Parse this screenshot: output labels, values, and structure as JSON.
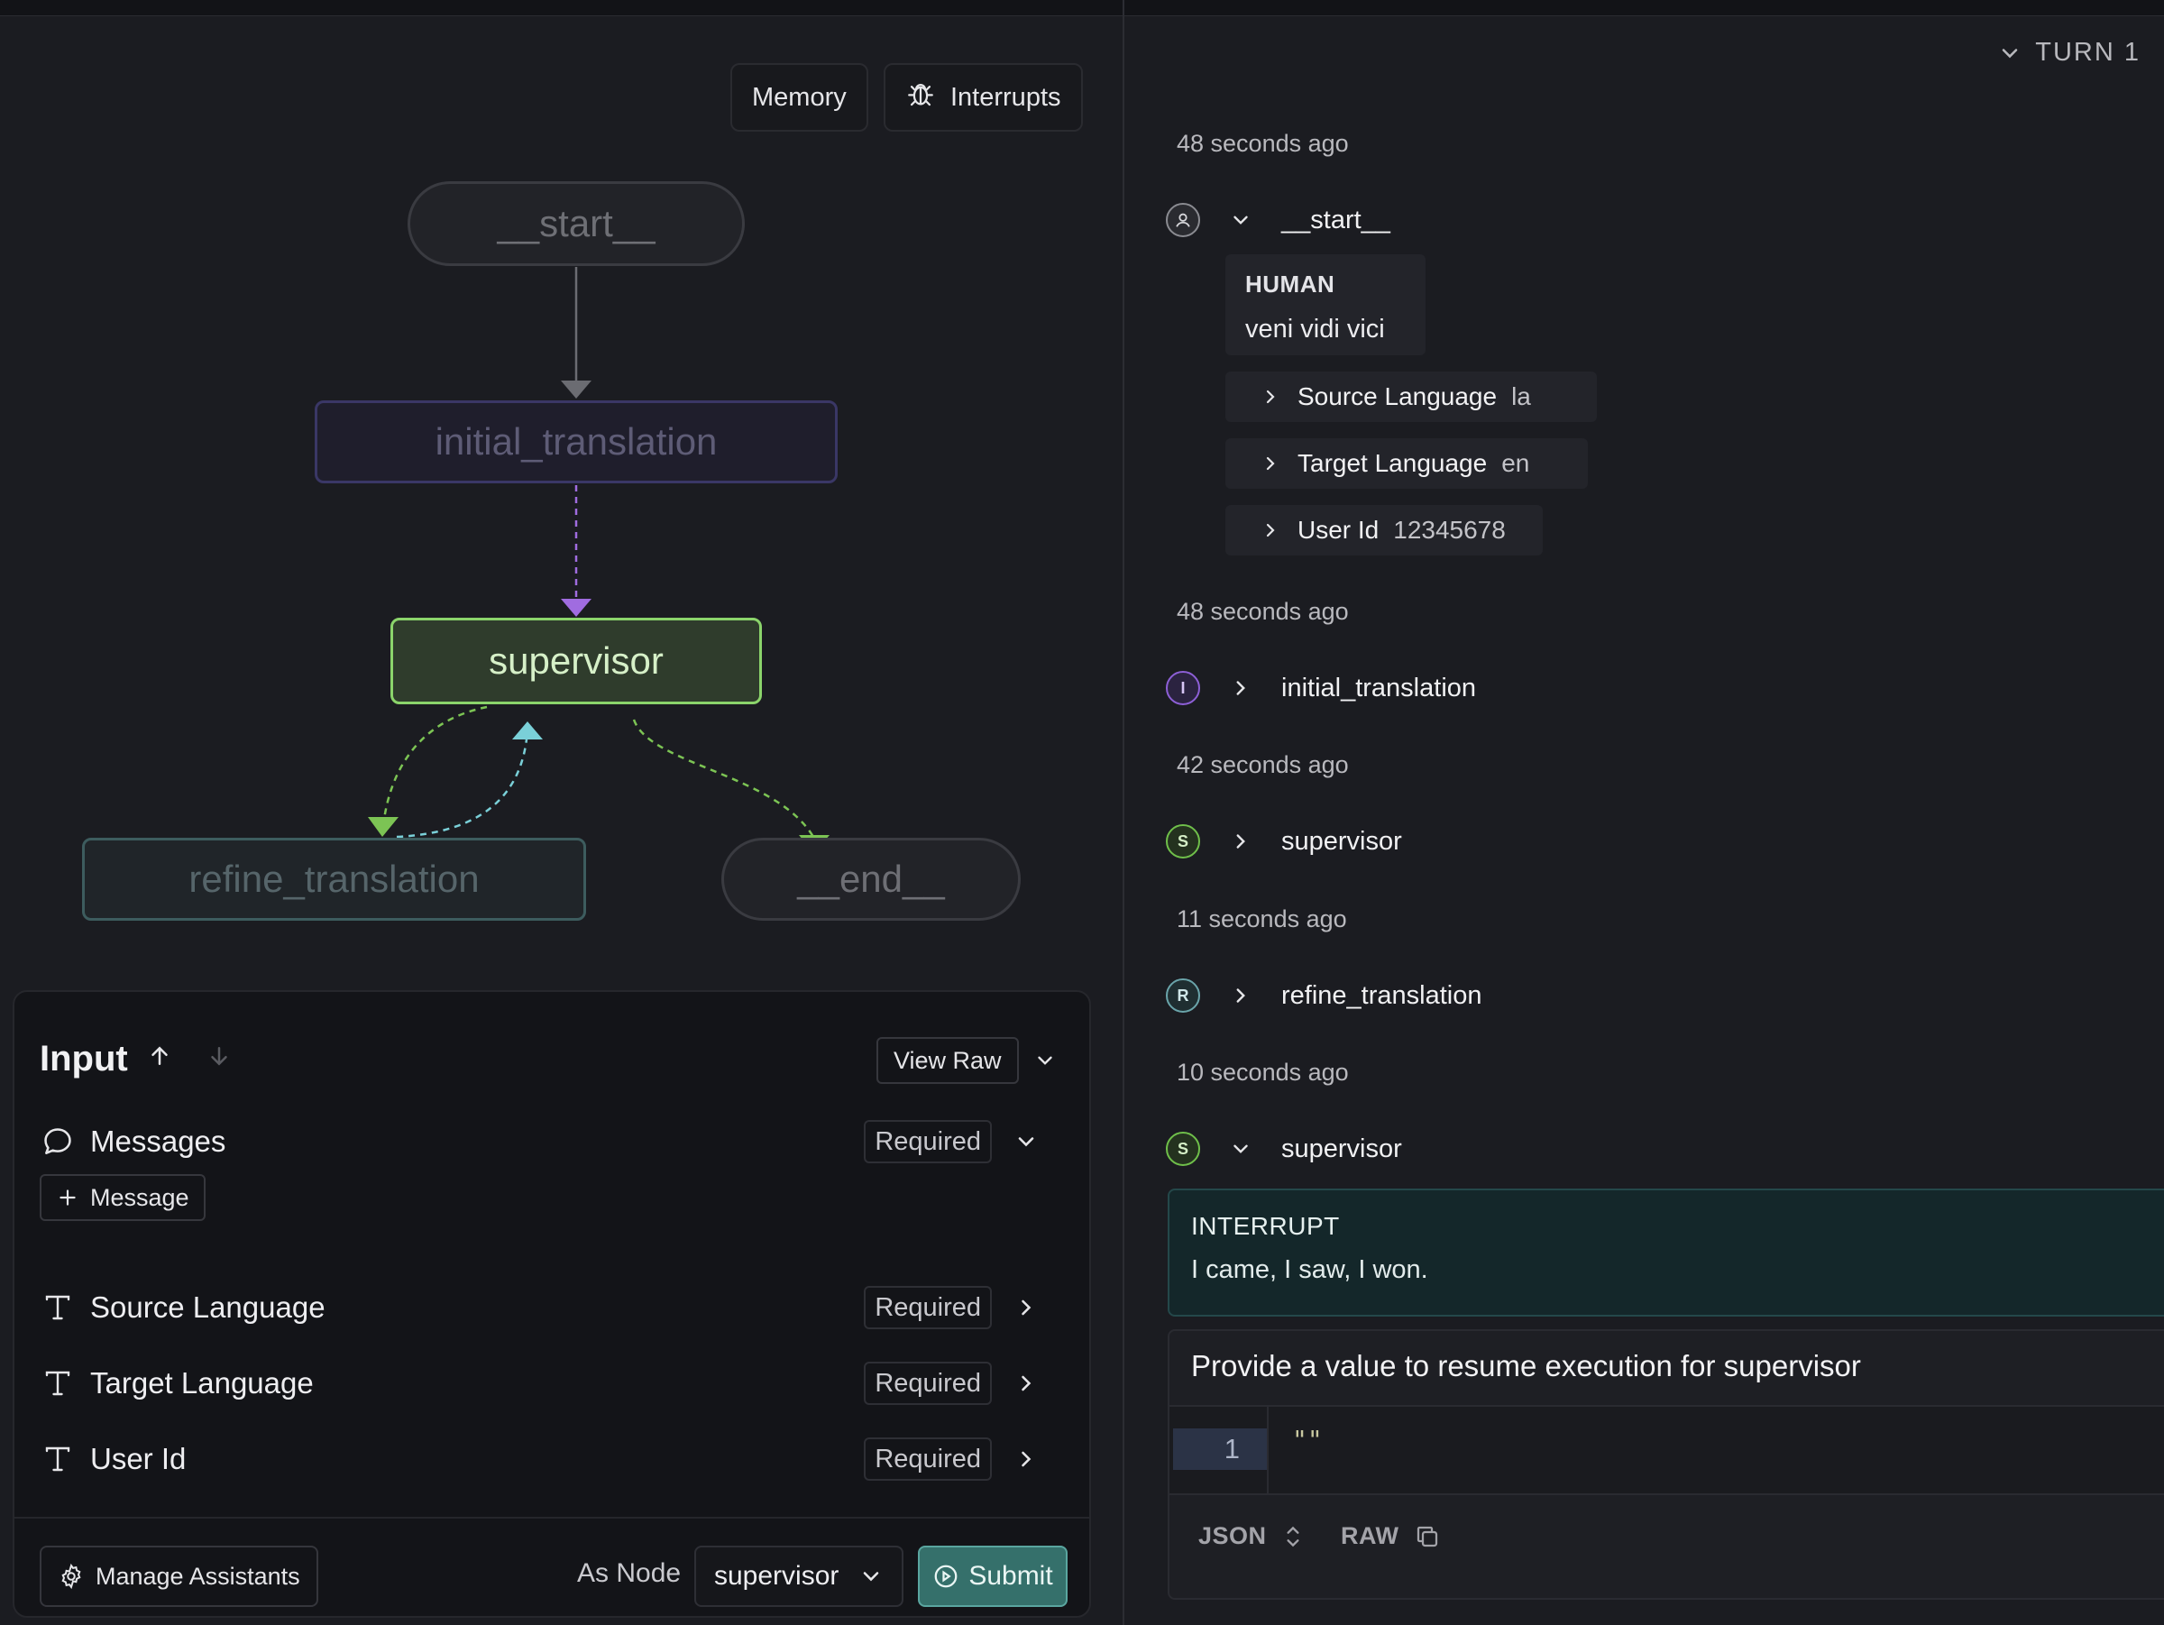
{
  "graph": {
    "toolbar": {
      "memory_label": "Memory",
      "interrupts_label": "Interrupts"
    },
    "nodes": {
      "start": "__start__",
      "initial_translation": "initial_translation",
      "supervisor": "supervisor",
      "refine_translation": "refine_translation",
      "end": "__end__"
    },
    "colors": {
      "supervisor_border": "#8bd46b",
      "supervisor_fill": "#2f3c2c",
      "initial_border": "#3a3766",
      "refine_border": "#3d5c5e",
      "edge_purple": "#a06ce0",
      "edge_green": "#7cc454",
      "edge_teal": "#7ad0d8"
    }
  },
  "input": {
    "title": "Input",
    "view_raw_label": "View Raw",
    "messages_label": "Messages",
    "required_label": "Required",
    "add_message_label": "Message",
    "fields": [
      {
        "label": "Source Language",
        "required": "Required"
      },
      {
        "label": "Target Language",
        "required": "Required"
      },
      {
        "label": "User Id",
        "required": "Required"
      }
    ],
    "manage_assistants_label": "Manage Assistants",
    "as_node_label": "As Node",
    "as_node_value": "supervisor",
    "submit_label": "Submit"
  },
  "thread": {
    "turn_label": "TURN 1",
    "events": [
      {
        "time": "48 seconds ago",
        "node": "__start__",
        "avatar": "person-icon"
      },
      {
        "time": "48 seconds ago",
        "node": "initial_translation",
        "avatar": "I"
      },
      {
        "time": "42 seconds ago",
        "node": "supervisor",
        "avatar": "S"
      },
      {
        "time": "11 seconds ago",
        "node": "refine_translation",
        "avatar": "R"
      },
      {
        "time": "10 seconds ago",
        "node": "supervisor",
        "avatar": "S"
      }
    ],
    "human_message": {
      "role": "HUMAN",
      "text": "veni vidi vici"
    },
    "state": [
      {
        "key": "Source Language",
        "value": "la"
      },
      {
        "key": "Target Language",
        "value": "en"
      },
      {
        "key": "User Id",
        "value": "12345678"
      }
    ],
    "interrupt": {
      "title": "INTERRUPT",
      "text": "I came, I saw, I won."
    },
    "resume": {
      "heading": "Provide a value to resume execution for supervisor",
      "line_number": "1",
      "code": "\"\"",
      "format_json": "JSON",
      "format_raw": "RAW"
    }
  }
}
